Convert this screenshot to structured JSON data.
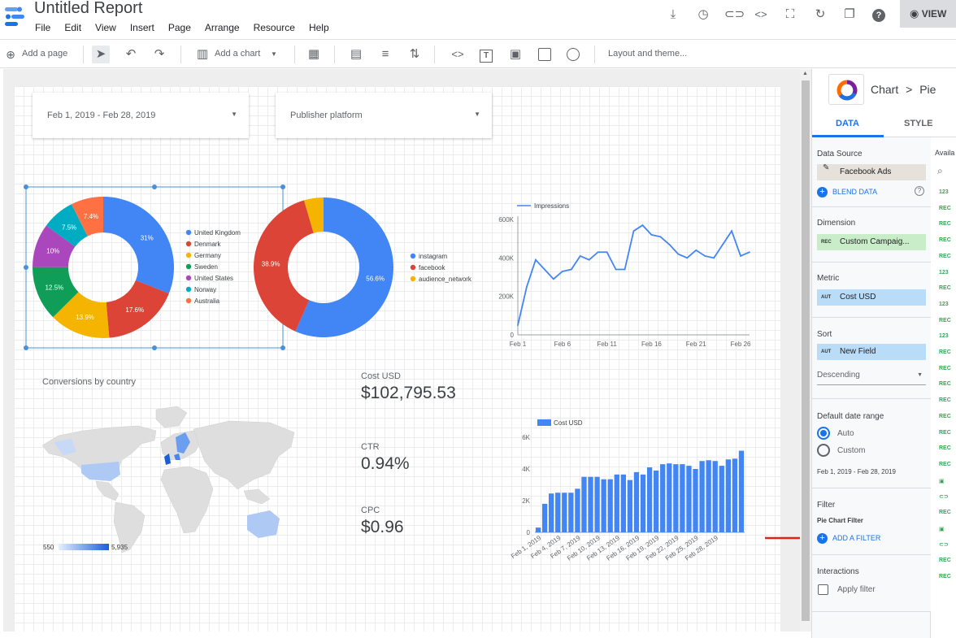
{
  "app": {
    "title": "Untitled Report",
    "menu": [
      "File",
      "Edit",
      "View",
      "Insert",
      "Page",
      "Arrange",
      "Resource",
      "Help"
    ],
    "view_button": "VIEW",
    "header_icons": [
      "download-icon",
      "history-icon",
      "link-icon",
      "embed-icon",
      "fullscreen-icon",
      "refresh-icon",
      "copy-icon",
      "help-icon"
    ]
  },
  "toolbar": {
    "add_page": "Add a page",
    "add_chart": "Add a chart",
    "layout_theme": "Layout and theme..."
  },
  "controls": {
    "date_range": "Feb 1, 2019 - Feb 28, 2019",
    "filter": "Publisher platform"
  },
  "scorecards": [
    {
      "label": "Cost USD",
      "value": "$102,795.53"
    },
    {
      "label": "CTR",
      "value": "0.94%"
    },
    {
      "label": "CPC",
      "value": "$0.96"
    }
  ],
  "map": {
    "title": "Conversions by country",
    "legend_min": "550",
    "legend_max": "5,935"
  },
  "chart_data": [
    {
      "type": "pie",
      "donut": true,
      "labels": [
        "United Kingdom",
        "Denmark",
        "Germany",
        "Sweden",
        "United States",
        "Norway",
        "Australia"
      ],
      "values": [
        31,
        17.6,
        13.9,
        12.5,
        10,
        7.5,
        7.4
      ],
      "data_labels": [
        "31%",
        "17.6%",
        "13.9%",
        "12.5%",
        "10%",
        "7.5%",
        "7.4%"
      ],
      "colors": [
        "#4285f4",
        "#db4437",
        "#f4b400",
        "#0f9d58",
        "#ab47bc",
        "#00acc1",
        "#ff7043"
      ],
      "legend": "right"
    },
    {
      "type": "pie",
      "donut": true,
      "labels": [
        "instagram",
        "facebook",
        "audience_network"
      ],
      "values": [
        56.6,
        38.9,
        4.5
      ],
      "data_labels": [
        "56.6%",
        "38.9%",
        ""
      ],
      "colors": [
        "#4285f4",
        "#db4437",
        "#f4b400"
      ],
      "legend": "right"
    },
    {
      "type": "line",
      "series": [
        {
          "name": "Impressions",
          "values": [
            50000,
            250000,
            390000,
            340000,
            290000,
            330000,
            340000,
            410000,
            390000,
            430000,
            430000,
            340000,
            340000,
            540000,
            570000,
            520000,
            510000,
            470000,
            420000,
            400000,
            440000,
            410000,
            400000,
            470000,
            540000,
            410000,
            430000
          ]
        }
      ],
      "x_ticks": [
        "Feb 1",
        "Feb 6",
        "Feb 11",
        "Feb 16",
        "Feb 21",
        "Feb 26"
      ],
      "y_ticks": [
        "0",
        "200K",
        "400K",
        "600K"
      ],
      "ylim": [
        0,
        600000
      ],
      "legend": "top-left",
      "grid": false
    },
    {
      "type": "bar",
      "series": [
        {
          "name": "Cost USD",
          "values": [
            300,
            1800,
            2450,
            2500,
            2500,
            2500,
            2750,
            3500,
            3500,
            3500,
            3350,
            3350,
            3650,
            3650,
            3300,
            3800,
            3650,
            4100,
            3900,
            4300,
            4350,
            4300,
            4300,
            4200,
            4000,
            4500,
            4550,
            4500,
            4200,
            4600,
            4650,
            5150
          ]
        }
      ],
      "categories": [
        "Feb 1, 2019",
        "Feb 4, 2019",
        "Feb 7, 2019",
        "Feb 10, 2019",
        "Feb 13, 2019",
        "Feb 16, 2019",
        "Feb 19, 2019",
        "Feb 22, 2019",
        "Feb 25, 2019",
        "Feb 28, 2019"
      ],
      "y_ticks": [
        "0",
        "2K",
        "4K",
        "6K"
      ],
      "ylim": [
        0,
        6000
      ],
      "legend": "top-left",
      "color": "#4285f4"
    }
  ],
  "panel": {
    "breadcrumb_chart": "Chart",
    "breadcrumb_sep": ">",
    "breadcrumb_type": "Pie",
    "tab_data": "DATA",
    "tab_style": "STYLE",
    "data_source_title": "Data Source",
    "data_source": "Facebook Ads",
    "blend_data": "BLEND DATA",
    "dimension_title": "Dimension",
    "dimension": "Custom Campaig...",
    "dimension_tag": "REC",
    "metric_title": "Metric",
    "metric": "Cost USD",
    "metric_tag": "AUT",
    "sort_title": "Sort",
    "sort": "New Field",
    "sort_tag": "AUT",
    "sort_order": "Descending",
    "date_range_title": "Default date range",
    "date_auto": "Auto",
    "date_custom": "Custom",
    "date_range_value": "Feb 1, 2019 - Feb 28, 2019",
    "filter_title": "Filter",
    "filter_sub": "Pie Chart Filter",
    "add_filter": "ADD A FILTER",
    "interactions_title": "Interactions",
    "apply_filter": "Apply filter",
    "avail_label": "Availa"
  }
}
